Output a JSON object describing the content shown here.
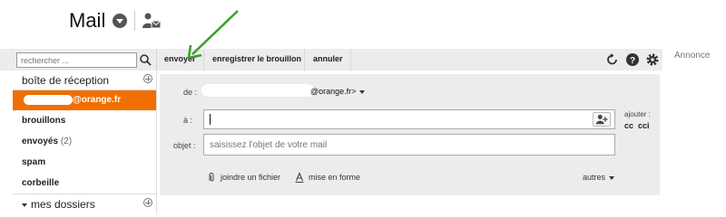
{
  "header": {
    "title": "Mail"
  },
  "toolbar": {
    "search_placeholder": "rechercher ...",
    "send_label": "envoyer",
    "save_draft_label": "enregistrer le brouillon",
    "cancel_label": "annuler",
    "ad_label": "Annonce"
  },
  "sidebar": {
    "inbox_label": "boîte de réception",
    "account_suffix": "@orange.fr",
    "items": [
      {
        "label": "brouillons",
        "count": ""
      },
      {
        "label": "envoyés",
        "count": "(2)"
      },
      {
        "label": "spam",
        "count": ""
      },
      {
        "label": "corbeille",
        "count": ""
      }
    ],
    "folders_label": "mes dossiers"
  },
  "compose": {
    "from_label": "de :",
    "from_value_suffix": "@orange.fr>",
    "to_label": "à :",
    "to_value": "",
    "subject_label": "objet :",
    "subject_placeholder": "saisissez l'objet de votre mail",
    "add_label": "ajouter :",
    "cc_label": "cc",
    "cci_label": "cci",
    "attach_label": "joindre un fichier",
    "format_label": "mise en forme",
    "more_label": "autres"
  },
  "colors": {
    "accent": "#f16e00",
    "toolbar_bg": "#ececec",
    "annotation_arrow": "#3a9e2a"
  }
}
